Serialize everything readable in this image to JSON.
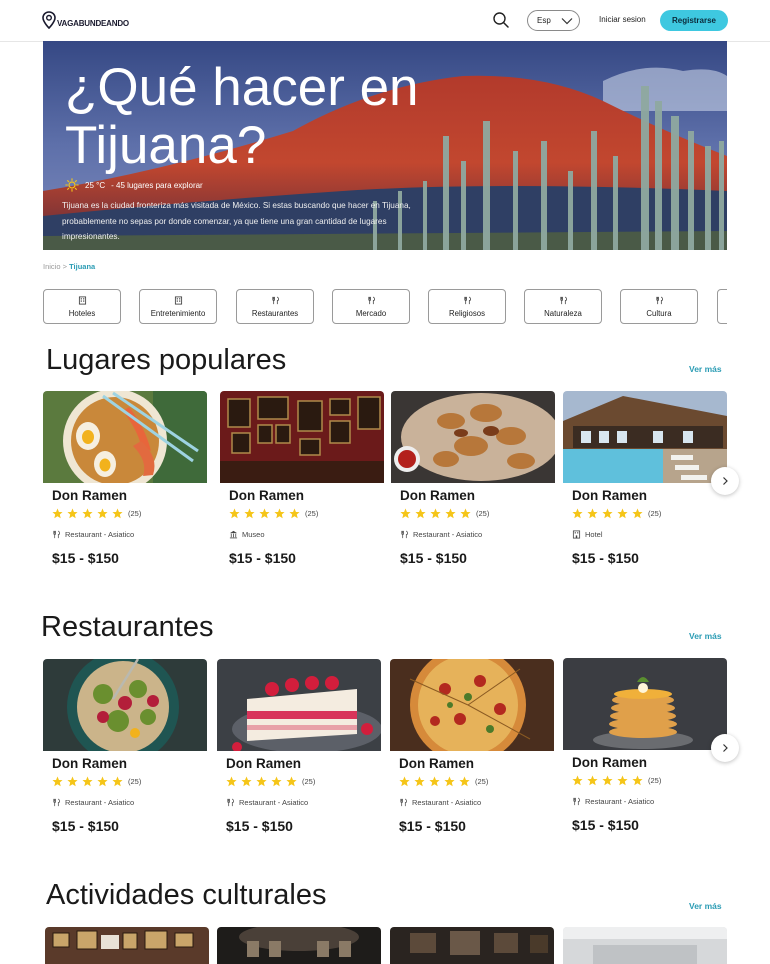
{
  "header": {
    "logo_text": "VAGABUNDEANDO",
    "language": "Esp",
    "login": "Iniciar sesion",
    "register": "Registrarse"
  },
  "hero": {
    "title": "¿Qué hacer en Tijuana?",
    "temperature": "25 °C",
    "places_count": "- 45 lugares para explorar",
    "description": "Tijuana es la ciudad fronteriza más visitada de México. Si estas buscando que hacer en Tijuana, probablemente no sepas por donde comenzar, ya que tiene una gran cantidad de lugares impresionantes."
  },
  "breadcrumb": {
    "home": "Inicio",
    "separator": ">",
    "current": "Tijuana"
  },
  "categories": [
    {
      "label": "Hoteles",
      "icon": "building-icon"
    },
    {
      "label": "Entretenimiento",
      "icon": "building-icon"
    },
    {
      "label": "Restaurantes",
      "icon": "fork-knife-icon"
    },
    {
      "label": "Mercado",
      "icon": "fork-knife-icon"
    },
    {
      "label": "Religiosos",
      "icon": "fork-knife-icon"
    },
    {
      "label": "Naturaleza",
      "icon": "fork-knife-icon"
    },
    {
      "label": "Cultura",
      "icon": "fork-knife-icon"
    }
  ],
  "popular": {
    "title": "Lugares populares",
    "see_more": "Ver más",
    "cards": [
      {
        "name": "Don Ramen",
        "reviews": "(25)",
        "type": "Restaurant - Asiatico",
        "type_icon": "fork-knife-icon",
        "price": "$15 - $150",
        "image": "ramen-bowl"
      },
      {
        "name": "Don Ramen",
        "reviews": "(25)",
        "type": "Museo",
        "type_icon": "museum-icon",
        "price": "$15 - $150",
        "image": "museum-gallery"
      },
      {
        "name": "Don Ramen",
        "reviews": "(25)",
        "type": "Restaurant - Asiatico",
        "type_icon": "fork-knife-icon",
        "price": "$15 - $150",
        "image": "grilled-meat"
      },
      {
        "name": "Don Ramen",
        "reviews": "(25)",
        "type": "Hotel",
        "type_icon": "hotel-icon",
        "price": "$15 - $150",
        "image": "hotel-pool"
      }
    ]
  },
  "restaurants": {
    "title": "Restaurantes",
    "see_more": "Ver más",
    "cards": [
      {
        "name": "Don Ramen",
        "reviews": "(25)",
        "type": "Restaurant - Asiatico",
        "type_icon": "fork-knife-icon",
        "price": "$15 - $150",
        "image": "salad-bowl"
      },
      {
        "name": "Don Ramen",
        "reviews": "(25)",
        "type": "Restaurant - Asiatico",
        "type_icon": "fork-knife-icon",
        "price": "$15 - $150",
        "image": "cake-slice"
      },
      {
        "name": "Don Ramen",
        "reviews": "(25)",
        "type": "Restaurant - Asiatico",
        "type_icon": "fork-knife-icon",
        "price": "$15 - $150",
        "image": "pizza"
      },
      {
        "name": "Don Ramen",
        "reviews": "(25)",
        "type": "Restaurant - Asiatico",
        "type_icon": "fork-knife-icon",
        "price": "$15 - $150",
        "image": "pancakes"
      }
    ]
  },
  "cultural": {
    "title": "Actividades culturales",
    "see_more": "Ver más"
  },
  "rating": 5,
  "colors": {
    "accent": "#3ec8e0",
    "link": "#2b9cb4",
    "star": "#f5c518"
  }
}
